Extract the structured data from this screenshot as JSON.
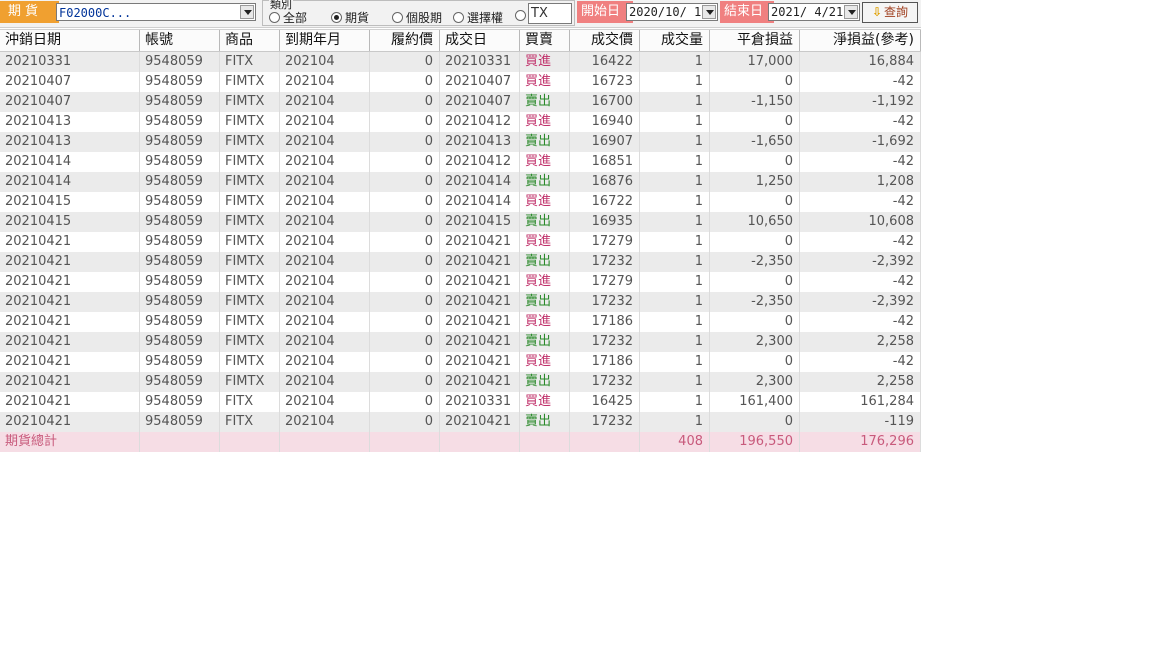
{
  "toolbar": {
    "futures_tag": "期貨",
    "account_value": "F02000C...",
    "category_label": "類別",
    "radio_options": [
      {
        "label": "全部",
        "selected": false
      },
      {
        "label": "期貨",
        "selected": true
      },
      {
        "label": "個股期",
        "selected": false
      },
      {
        "label": "選擇權",
        "selected": false
      }
    ],
    "product_code": "TX",
    "start_label": "開始日",
    "start_date": "2020/10/ 1",
    "end_label": "結束日",
    "end_date": "2021/ 4/21",
    "query_label": "查詢",
    "colors": {
      "futures_tag": "#f0a030",
      "date_tag": "#f08080",
      "buy": "#c0306a",
      "sell": "#2a8a2a"
    }
  },
  "table": {
    "columns": [
      "沖銷日期",
      "帳號",
      "商品",
      "到期年月",
      "履約價",
      "成交日",
      "買賣",
      "成交價",
      "成交量",
      "平倉損益",
      "淨損益(參考)"
    ],
    "rows": [
      [
        "20210331",
        "9548059",
        "FITX",
        "202104",
        "0",
        "20210331",
        "買進",
        "16422",
        "1",
        "17,000",
        "16,884"
      ],
      [
        "20210407",
        "9548059",
        "FIMTX",
        "202104",
        "0",
        "20210407",
        "買進",
        "16723",
        "1",
        "0",
        "-42"
      ],
      [
        "20210407",
        "9548059",
        "FIMTX",
        "202104",
        "0",
        "20210407",
        "賣出",
        "16700",
        "1",
        "-1,150",
        "-1,192"
      ],
      [
        "20210413",
        "9548059",
        "FIMTX",
        "202104",
        "0",
        "20210412",
        "買進",
        "16940",
        "1",
        "0",
        "-42"
      ],
      [
        "20210413",
        "9548059",
        "FIMTX",
        "202104",
        "0",
        "20210413",
        "賣出",
        "16907",
        "1",
        "-1,650",
        "-1,692"
      ],
      [
        "20210414",
        "9548059",
        "FIMTX",
        "202104",
        "0",
        "20210412",
        "買進",
        "16851",
        "1",
        "0",
        "-42"
      ],
      [
        "20210414",
        "9548059",
        "FIMTX",
        "202104",
        "0",
        "20210414",
        "賣出",
        "16876",
        "1",
        "1,250",
        "1,208"
      ],
      [
        "20210415",
        "9548059",
        "FIMTX",
        "202104",
        "0",
        "20210414",
        "買進",
        "16722",
        "1",
        "0",
        "-42"
      ],
      [
        "20210415",
        "9548059",
        "FIMTX",
        "202104",
        "0",
        "20210415",
        "賣出",
        "16935",
        "1",
        "10,650",
        "10,608"
      ],
      [
        "20210421",
        "9548059",
        "FIMTX",
        "202104",
        "0",
        "20210421",
        "買進",
        "17279",
        "1",
        "0",
        "-42"
      ],
      [
        "20210421",
        "9548059",
        "FIMTX",
        "202104",
        "0",
        "20210421",
        "賣出",
        "17232",
        "1",
        "-2,350",
        "-2,392"
      ],
      [
        "20210421",
        "9548059",
        "FIMTX",
        "202104",
        "0",
        "20210421",
        "買進",
        "17279",
        "1",
        "0",
        "-42"
      ],
      [
        "20210421",
        "9548059",
        "FIMTX",
        "202104",
        "0",
        "20210421",
        "賣出",
        "17232",
        "1",
        "-2,350",
        "-2,392"
      ],
      [
        "20210421",
        "9548059",
        "FIMTX",
        "202104",
        "0",
        "20210421",
        "買進",
        "17186",
        "1",
        "0",
        "-42"
      ],
      [
        "20210421",
        "9548059",
        "FIMTX",
        "202104",
        "0",
        "20210421",
        "賣出",
        "17232",
        "1",
        "2,300",
        "2,258"
      ],
      [
        "20210421",
        "9548059",
        "FIMTX",
        "202104",
        "0",
        "20210421",
        "買進",
        "17186",
        "1",
        "0",
        "-42"
      ],
      [
        "20210421",
        "9548059",
        "FIMTX",
        "202104",
        "0",
        "20210421",
        "賣出",
        "17232",
        "1",
        "2,300",
        "2,258"
      ],
      [
        "20210421",
        "9548059",
        "FITX",
        "202104",
        "0",
        "20210331",
        "買進",
        "16425",
        "1",
        "161,400",
        "161,284"
      ],
      [
        "20210421",
        "9548059",
        "FITX",
        "202104",
        "0",
        "20210421",
        "賣出",
        "17232",
        "1",
        "0",
        "-119"
      ]
    ],
    "total": {
      "label": "期貨總計",
      "volume": "408",
      "close_pl": "196,550",
      "net_pl": "176,296"
    }
  }
}
